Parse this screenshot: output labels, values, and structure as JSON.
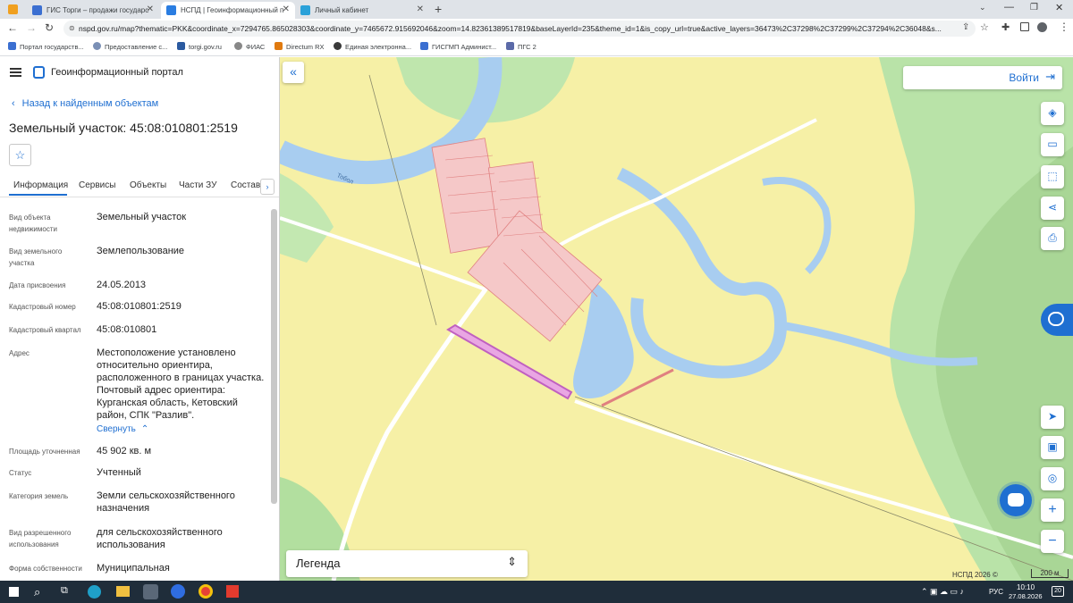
{
  "browser": {
    "tabs": [
      {
        "label": "ГИС Торги – продажи государс",
        "icon_color": "#3b6fd1"
      },
      {
        "label": "НСПД | Геоинформационный п",
        "icon_color": "#2a7de1"
      },
      {
        "label": "Личный кабинет",
        "icon_color": "#2aa1d9"
      }
    ],
    "url": "nspd.gov.ru/map?thematic=PKK&coordinate_x=7294765.865028303&coordinate_y=7465672.915692046&zoom=14.82361389517819&baseLayerId=235&theme_id=1&is_copy_url=true&active_layers=36473%2C37298%2C37299%2C37294%2C36048&s...",
    "bookmarks": [
      "Портал государств...",
      "Предоставление с...",
      "torgi.gov.ru",
      "ФИАС",
      "Directum RX",
      "Единая электронна...",
      "ГИСГМП Админист...",
      "ПГС 2"
    ]
  },
  "header": {
    "title": "Геоинформационный портал"
  },
  "panel": {
    "back_link": "Назад к найденным объектам",
    "object_title": "Земельный участок: 45:08:010801:2519",
    "tabs": [
      "Информация",
      "Сервисы",
      "Объекты",
      "Части ЗУ",
      "Состав"
    ],
    "fields": [
      {
        "label": "Вид объекта недвижимости",
        "value": "Земельный участок"
      },
      {
        "label": "Вид земельного участка",
        "value": "Землепользование"
      },
      {
        "label": "Дата присвоения",
        "value": "24.05.2013"
      },
      {
        "label": "Кадастровый номер",
        "value": "45:08:010801:2519"
      },
      {
        "label": "Кадастровый квартал",
        "value": "45:08:010801"
      },
      {
        "label": "Адрес",
        "value": "Местоположение установлено относительно ориентира, расположенного в границах участка. Почтовый адрес ориентира: Курганская область, Кетовский район, СПК \"Разлив\"."
      },
      {
        "label": "Площадь уточненная",
        "value": "45 902 кв. м"
      },
      {
        "label": "Статус",
        "value": "Учтенный"
      },
      {
        "label": "Категория земель",
        "value": "Земли сельскохозяйственного назначения"
      },
      {
        "label": "Вид разрешенного использования",
        "value": "для сельскохозяйственного использования"
      },
      {
        "label": "Форма собственности",
        "value": "Муниципальная"
      }
    ],
    "collapse_link": "Свернуть"
  },
  "map": {
    "login_label": "Войти",
    "legend_label": "Легенда",
    "river_label": "Тобол",
    "copyright": "НСПД 2026 ©",
    "scale_label": "200 м"
  },
  "taskbar": {
    "lang": "РУС",
    "time": "10:10",
    "date": "27.08.2026",
    "notif_count": "20"
  },
  "colors": {
    "map_bg": "#f6f0a6",
    "forest": "#b9e3a8",
    "water": "#a8cdf0",
    "parcel_outline": "#e08080",
    "selected_parcel": "#c060c0",
    "accent": "#1f6fd1",
    "taskbar": "#1f2d3a"
  }
}
